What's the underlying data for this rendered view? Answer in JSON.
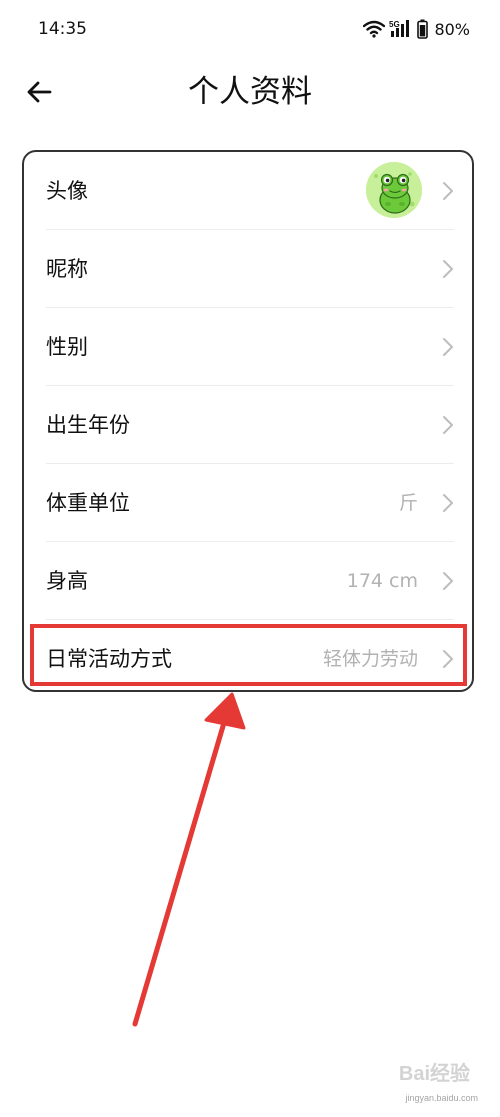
{
  "status_bar": {
    "time": "14:35",
    "network": "5G",
    "battery": "80%"
  },
  "header": {
    "title": "个人资料",
    "back_icon": "arrow-left-icon"
  },
  "profile_items": [
    {
      "label": "头像",
      "value": "",
      "has_avatar": true
    },
    {
      "label": "昵称",
      "value": ""
    },
    {
      "label": "性别",
      "value": ""
    },
    {
      "label": "出生年份",
      "value": ""
    },
    {
      "label": "体重单位",
      "value": "斤"
    },
    {
      "label": "身高",
      "value": "174 cm"
    },
    {
      "label": "日常活动方式",
      "value": "轻体力劳动"
    }
  ],
  "annotation": {
    "highlight_color": "#e53935",
    "highlighted_item": "日常活动方式"
  },
  "watermark": {
    "brand": "Bai经验",
    "url": "jingyan.baidu.com"
  }
}
